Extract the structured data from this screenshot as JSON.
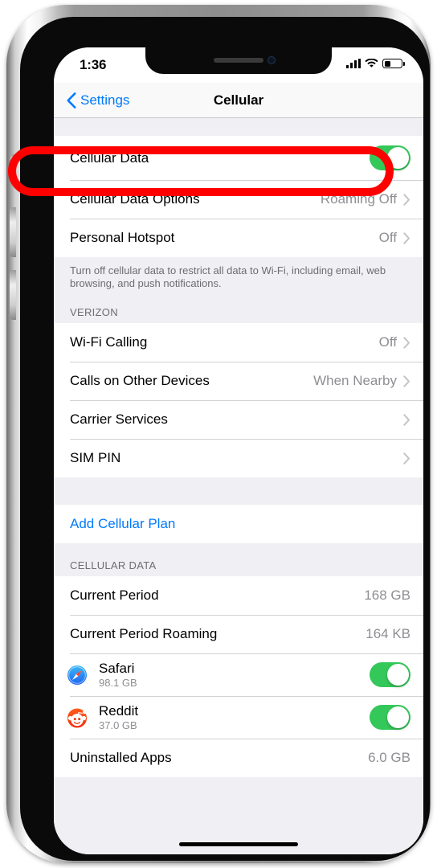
{
  "status_bar": {
    "time": "1:36",
    "signal_icon": "cellular-bars-icon",
    "wifi_icon": "wifi-icon",
    "battery_icon": "battery-icon",
    "battery_level_pct": 38
  },
  "nav_bar": {
    "back_label": "Settings",
    "back_icon": "chevron-left-icon",
    "title": "Cellular"
  },
  "sections": {
    "data_group": {
      "rows": [
        {
          "label": "Cellular Data",
          "control": "toggle",
          "toggle_on": true
        },
        {
          "label": "Cellular Data Options",
          "value": "Roaming Off",
          "control": "chevron"
        },
        {
          "label": "Personal Hotspot",
          "value": "Off",
          "control": "chevron"
        }
      ],
      "footer": "Turn off cellular data to restrict all data to Wi-Fi, including email, web browsing, and push notifications."
    },
    "carrier_group": {
      "header": "VERIZON",
      "rows": [
        {
          "label": "Wi-Fi Calling",
          "value": "Off",
          "control": "chevron"
        },
        {
          "label": "Calls on Other Devices",
          "value": "When Nearby",
          "control": "chevron"
        },
        {
          "label": "Carrier Services",
          "value": "",
          "control": "chevron"
        },
        {
          "label": "SIM PIN",
          "value": "",
          "control": "chevron"
        }
      ]
    },
    "plan_group": {
      "rows": [
        {
          "label": "Add Cellular Plan",
          "style": "link"
        }
      ]
    },
    "usage_group": {
      "header": "CELLULAR DATA",
      "rows": [
        {
          "label": "Current Period",
          "value": "168 GB"
        },
        {
          "label": "Current Period Roaming",
          "value": "164 KB"
        }
      ],
      "apps": [
        {
          "name": "Safari",
          "size": "98.1 GB",
          "icon": "safari-icon",
          "toggle_on": true
        },
        {
          "name": "Reddit",
          "size": "37.0 GB",
          "icon": "reddit-icon",
          "toggle_on": true
        }
      ],
      "last_row": {
        "label": "Uninstalled Apps",
        "value": "6.0 GB"
      }
    }
  },
  "annotation": {
    "shape": "rounded-rectangle-highlight",
    "color": "#ff0000",
    "targets": "Cellular Data row"
  },
  "colors": {
    "accent_blue": "#007aff",
    "toggle_green": "#34c759",
    "group_bg": "#efeff4",
    "secondary_text": "#8e8e93"
  }
}
